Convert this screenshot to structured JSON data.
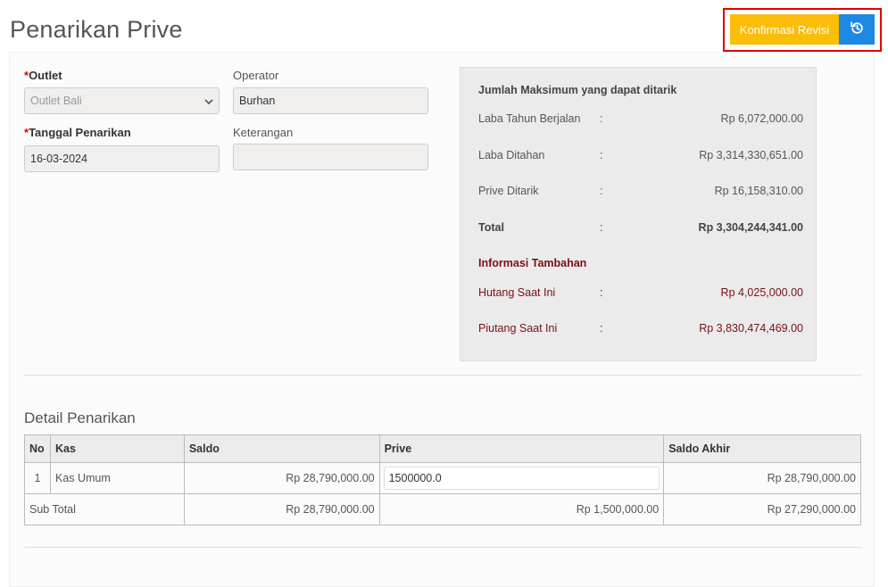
{
  "page": {
    "title": "Penarikan Prive"
  },
  "toolbar": {
    "confirm_label": "Konfirmasi Revisi",
    "history_icon": "history-icon"
  },
  "form": {
    "outlet": {
      "label": "Outlet",
      "value": "Outlet Bali"
    },
    "operator": {
      "label": "Operator",
      "value": "Burhan"
    },
    "tanggal": {
      "label": "Tanggal Penarikan",
      "value": "16-03-2024"
    },
    "keterangan": {
      "label": "Keterangan",
      "value": ""
    }
  },
  "summary": {
    "title": "Jumlah Maksimum yang dapat ditarik",
    "rows": [
      {
        "label": "Laba Tahun Berjalan",
        "sep": ":",
        "value": "Rp 6,072,000.00"
      },
      {
        "label": "Laba Ditahan",
        "sep": ":",
        "value": "Rp 3,314,330,651.00"
      },
      {
        "label": "Prive Ditarik",
        "sep": ":",
        "value": "Rp 16,158,310.00"
      },
      {
        "label": "Total",
        "sep": ":",
        "value": "Rp 3,304,244,341.00"
      }
    ],
    "extra_title": "Informasi Tambahan",
    "extra_rows": [
      {
        "label": "Hutang Saat Ini",
        "sep": ":",
        "value": "Rp 4,025,000.00"
      },
      {
        "label": "Piutang Saat Ini",
        "sep": ":",
        "value": "Rp 3,830,474,469.00"
      }
    ]
  },
  "detail": {
    "title": "Detail Penarikan",
    "headers": {
      "no": "No",
      "kas": "Kas",
      "saldo": "Saldo",
      "prive": "Prive",
      "saldo_akhir": "Saldo Akhir"
    },
    "rows": [
      {
        "no": "1",
        "kas": "Kas Umum",
        "saldo": "Rp 28,790,000.00",
        "prive": "1500000.0",
        "saldo_akhir": "Rp 28,790,000.00"
      }
    ],
    "subtotal": {
      "label": "Sub Total",
      "saldo": "Rp 28,790,000.00",
      "prive": "Rp 1,500,000.00",
      "saldo_akhir": "Rp 27,290,000.00"
    }
  },
  "colors": {
    "confirm": "#fbbd08",
    "history": "#1e88e5",
    "highlight": "#e00000",
    "maroon": "#7a1010"
  }
}
